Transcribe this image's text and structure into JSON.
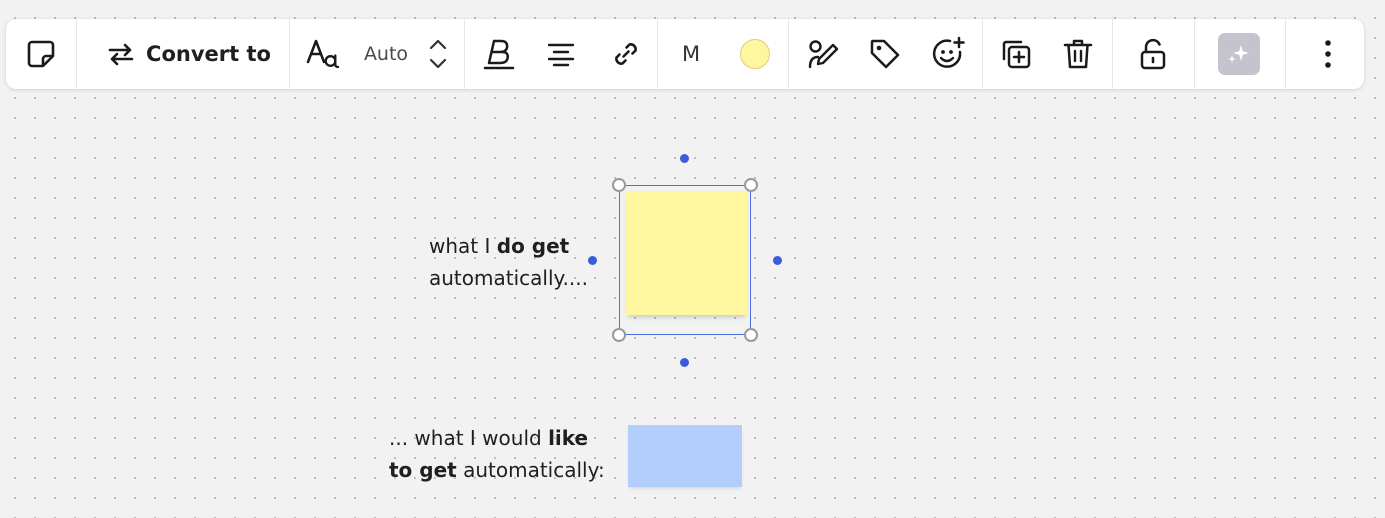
{
  "toolbar": {
    "convert_label": "Convert to",
    "font_size_value": "Auto",
    "sticky_size_label": "M",
    "note_color": "#fff6a0",
    "icons": [
      "sticky-note-icon",
      "swap-arrows-icon",
      "font-family-icon",
      "chevron-up-icon",
      "chevron-down-icon",
      "bold-icon",
      "align-center-icon",
      "link-icon",
      "pen-edit-icon",
      "tag-icon",
      "emoji-add-icon",
      "duplicate-icon",
      "trash-icon",
      "unlock-icon",
      "ai-sparkle-icon",
      "more-vertical-icon"
    ]
  },
  "canvas": {
    "caption1": {
      "part1": "what I ",
      "bold": "do get",
      "part2": "automatically...."
    },
    "caption2": {
      "part1": "... what I would ",
      "bold1": "like",
      "bold2": "to get",
      "part2": " automatically:"
    },
    "colors": {
      "yellow_note": "#fff6a0",
      "blue_note": "#b3cdfd",
      "selection": "#4f6fe8",
      "canvas_bg": "#f2f2f2"
    }
  }
}
